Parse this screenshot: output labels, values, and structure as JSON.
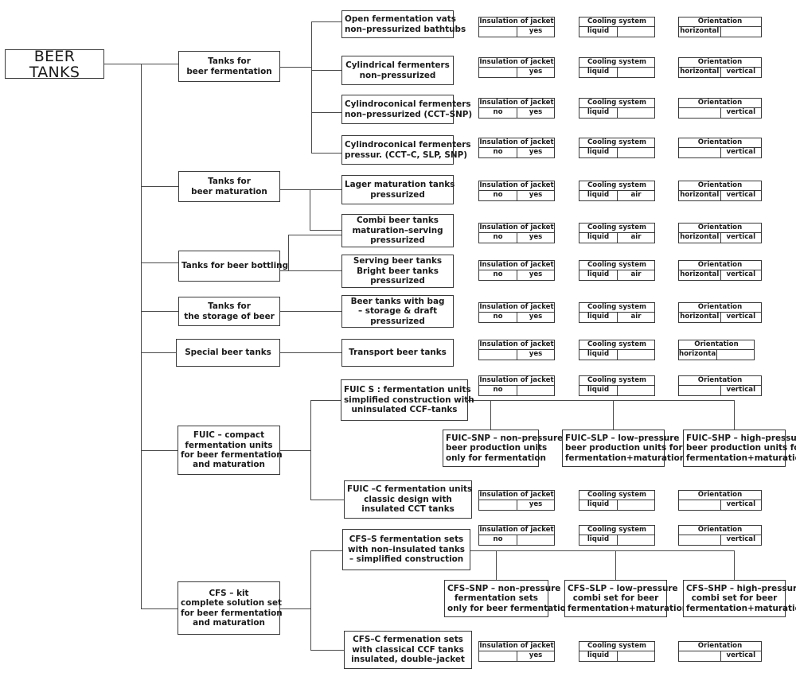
{
  "diagram": {
    "title": "BEER TANKS",
    "root_label": "BEER TANKS",
    "attribute_headers": {
      "insulation": "Insulation of jacket",
      "cooling": "Cooling system",
      "orientation": "Orientation"
    },
    "attribute_values": {
      "no": "no",
      "yes": "yes",
      "liquid": "liquid",
      "air": "air",
      "horizontal": "horizontal",
      "vertical": "vertical",
      "blank": ""
    },
    "categories": [
      {
        "id": "fermentation",
        "label_lines": [
          "Tanks for",
          "beer fermentation"
        ]
      },
      {
        "id": "maturation",
        "label_lines": [
          "Tanks for",
          "beer maturation"
        ]
      },
      {
        "id": "bottling",
        "label_lines": [
          "Tanks for beer bottling"
        ]
      },
      {
        "id": "storage",
        "label_lines": [
          "Tanks for",
          "the storage of beer"
        ]
      },
      {
        "id": "special",
        "label_lines": [
          "Special beer tanks"
        ]
      },
      {
        "id": "fuic",
        "label_lines": [
          "FUIC – compact",
          "fermentation units",
          "for beer fermentation",
          "and maturation"
        ]
      },
      {
        "id": "cfs",
        "label_lines": [
          "CFS – kit",
          "complete solution set",
          "for beer fermentation",
          "and maturation"
        ]
      }
    ],
    "products": [
      {
        "id": "open-vats",
        "label_lines": [
          "Open fermentation vats",
          "non–pressurized bathtubs"
        ],
        "insulation": [
          "",
          "yes"
        ],
        "cooling": [
          "liquid",
          ""
        ],
        "orientation": [
          "horizontal",
          ""
        ]
      },
      {
        "id": "cyl-ferm",
        "label_lines": [
          "Cylindrical fermenters",
          "non–pressurized"
        ],
        "insulation": [
          "",
          "yes"
        ],
        "cooling": [
          "liquid",
          ""
        ],
        "orientation": [
          "horizontal",
          "vertical"
        ]
      },
      {
        "id": "ccf-snp",
        "label_lines": [
          "Cylindroconical fermenters",
          "non–pressurized (CCT–SNP)"
        ],
        "insulation": [
          "no",
          "yes"
        ],
        "cooling": [
          "liquid",
          ""
        ],
        "orientation": [
          "",
          "vertical"
        ]
      },
      {
        "id": "ccf-pressur",
        "label_lines": [
          "Cylindroconical fermenters",
          "pressur. (CCT–C, SLP, SNP)"
        ],
        "insulation": [
          "no",
          "yes"
        ],
        "cooling": [
          "liquid",
          ""
        ],
        "orientation": [
          "",
          "vertical"
        ]
      },
      {
        "id": "lager-mat",
        "label_lines": [
          "Lager maturation tanks",
          "pressurized"
        ],
        "insulation": [
          "no",
          "yes"
        ],
        "cooling": [
          "liquid",
          "air"
        ],
        "orientation": [
          "horizontal",
          "vertical"
        ]
      },
      {
        "id": "combi",
        "label_lines": [
          "Combi beer tanks",
          "maturation–serving",
          "pressurized"
        ],
        "insulation": [
          "no",
          "yes"
        ],
        "cooling": [
          "liquid",
          "air"
        ],
        "orientation": [
          "horizontal",
          "vertical"
        ]
      },
      {
        "id": "serving",
        "label_lines": [
          "Serving beer tanks",
          "Bright beer tanks",
          "pressurized"
        ],
        "insulation": [
          "no",
          "yes"
        ],
        "cooling": [
          "liquid",
          "air"
        ],
        "orientation": [
          "horizontal",
          "vertical"
        ]
      },
      {
        "id": "bag",
        "label_lines": [
          "Beer tanks with bag",
          "– storage & draft",
          "pressurized"
        ],
        "insulation": [
          "no",
          "yes"
        ],
        "cooling": [
          "liquid",
          "air"
        ],
        "orientation": [
          "horizontal",
          "vertical"
        ]
      },
      {
        "id": "transport",
        "label_lines": [
          "Transport beer tanks"
        ],
        "insulation": [
          "",
          "yes"
        ],
        "cooling": [
          "liquid",
          ""
        ],
        "orientation": [
          "horizontal",
          ""
        ]
      },
      {
        "id": "fuic-s",
        "label_lines": [
          "FUIC S : fermentation units",
          "simplified construction with",
          "uninsulated CCF–tanks"
        ],
        "insulation": [
          "no",
          ""
        ],
        "cooling": [
          "liquid",
          ""
        ],
        "orientation": [
          "",
          "vertical"
        ]
      },
      {
        "id": "fuic-c",
        "label_lines": [
          "FUIC –C fermentation units",
          "classic design with",
          "insulated CCT tanks"
        ],
        "insulation": [
          "",
          "yes"
        ],
        "cooling": [
          "liquid",
          ""
        ],
        "orientation": [
          "",
          "vertical"
        ]
      },
      {
        "id": "cfs-s",
        "label_lines": [
          "CFS–S fermentation sets",
          "with non–insulated tanks",
          "– simplified construction"
        ],
        "insulation": [
          "no",
          ""
        ],
        "cooling": [
          "liquid",
          ""
        ],
        "orientation": [
          "",
          "vertical"
        ]
      },
      {
        "id": "cfs-c",
        "label_lines": [
          "CFS–C fermenation sets",
          "with classical CCF tanks",
          "insulated, double–jacket"
        ],
        "insulation": [
          "",
          "yes"
        ],
        "cooling": [
          "liquid",
          ""
        ],
        "orientation": [
          "",
          "vertical"
        ]
      }
    ],
    "variants": [
      {
        "id": "fuic-snp",
        "label_lines": [
          "FUIC–SNP – non–pressure",
          "beer production units",
          "only for fermentation"
        ]
      },
      {
        "id": "fuic-slp",
        "label_lines": [
          "FUIC–SLP – low–pressure",
          "beer production units for",
          "fermentation+maturation"
        ]
      },
      {
        "id": "fuic-shp",
        "label_lines": [
          "FUIC–SHP – high–pressure",
          "beer production units for",
          "fermentation+maturation"
        ]
      },
      {
        "id": "cfs-snp",
        "label_lines": [
          "CFS–SNP – non–pressure",
          "fermentation sets",
          "only for beer fermentation"
        ]
      },
      {
        "id": "cfs-slp",
        "label_lines": [
          "CFS–SLP – low–pressure",
          "combi set for beer",
          "fermentation+maturation"
        ]
      },
      {
        "id": "cfs-shp",
        "label_lines": [
          "CFS–SHP – high–pressure",
          "combi set for beer",
          "fermentation+maturation"
        ]
      }
    ]
  }
}
